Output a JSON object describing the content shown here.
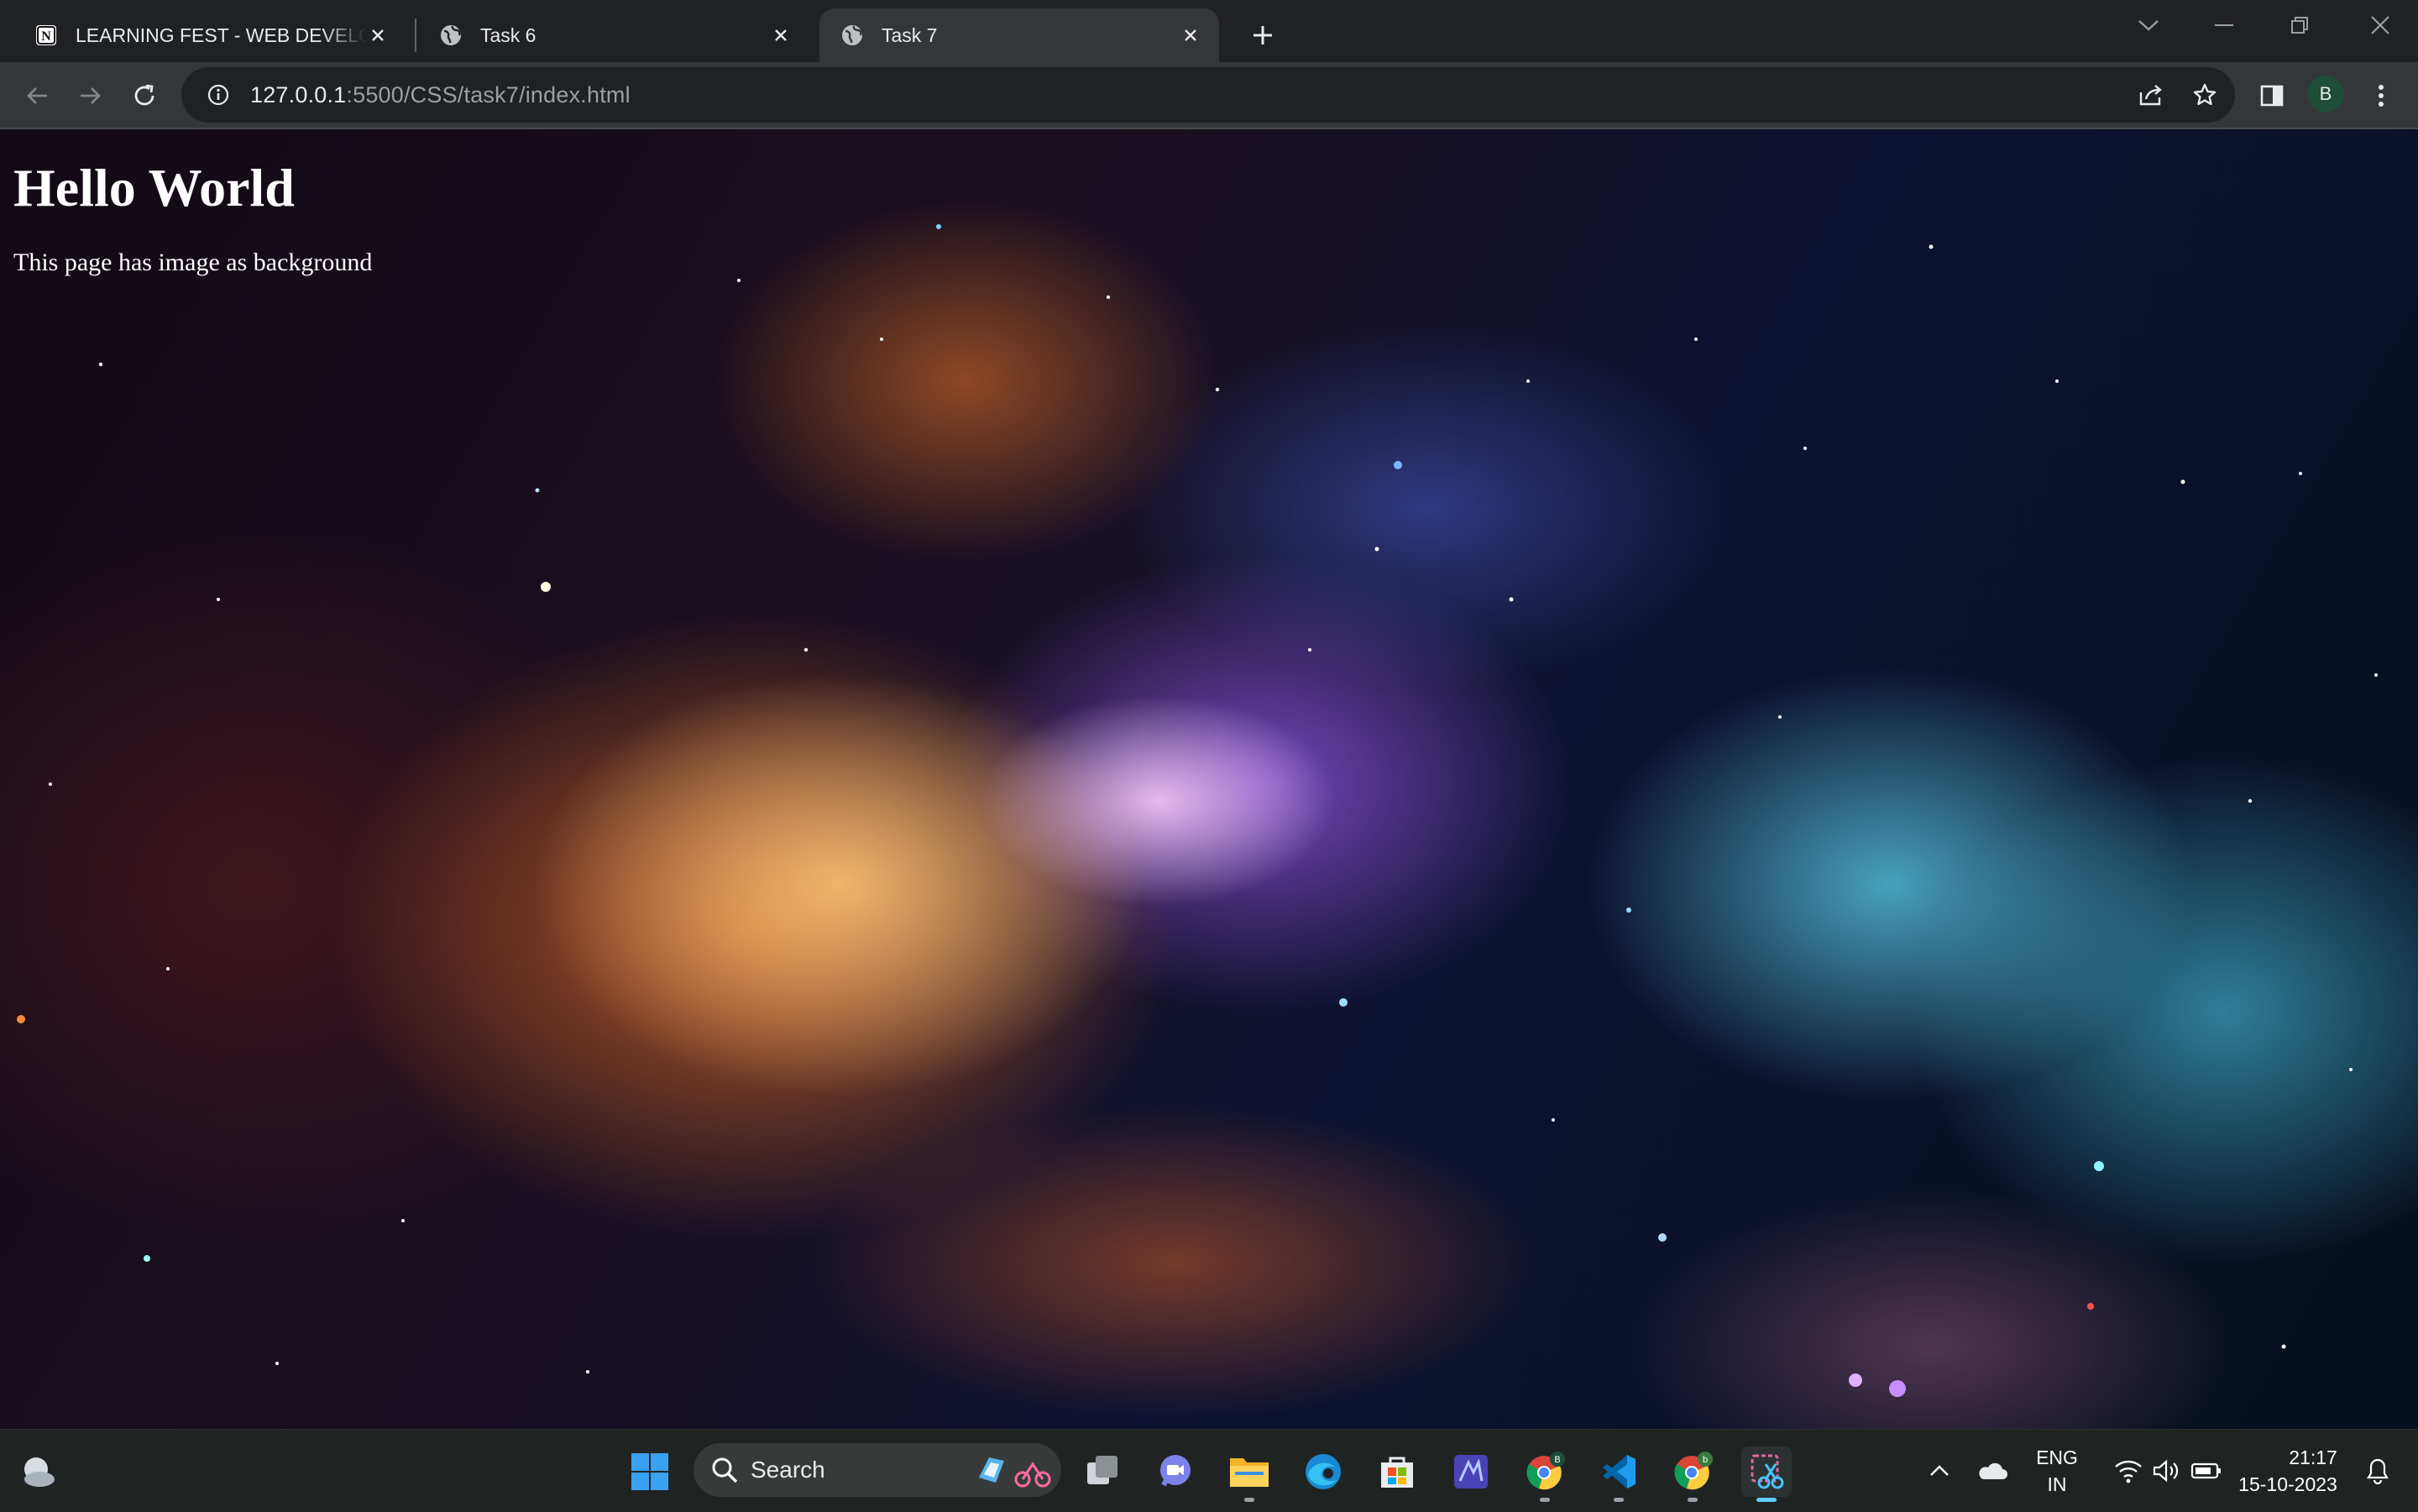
{
  "browser": {
    "tabs": [
      {
        "title": "LEARNING FEST - WEB DEVELOPER",
        "icon": "notion-icon",
        "active": false
      },
      {
        "title": "Task 6",
        "icon": "globe-icon",
        "active": false
      },
      {
        "title": "Task 7",
        "icon": "globe-icon",
        "active": true
      }
    ],
    "address": {
      "host": "127.0.0.1",
      "path": ":5500/CSS/task7/index.html"
    },
    "profile_initial": "B"
  },
  "page": {
    "heading": "Hello World",
    "paragraph": "This page has image as background"
  },
  "taskbar": {
    "search_label": "Search",
    "apps": [
      "windows-start",
      "task-view",
      "teams-chat",
      "file-explorer",
      "edge",
      "microsoft-store",
      "visual-studio",
      "chrome-profile-b",
      "vscode",
      "chrome",
      "snipping-tool"
    ],
    "language": {
      "line1": "ENG",
      "line2": "IN"
    },
    "time": "21:17",
    "date": "15-10-2023"
  },
  "colors": {
    "accent": "#60cdff",
    "chrome_bg": "#202124",
    "toolbar_bg": "#35363a"
  }
}
